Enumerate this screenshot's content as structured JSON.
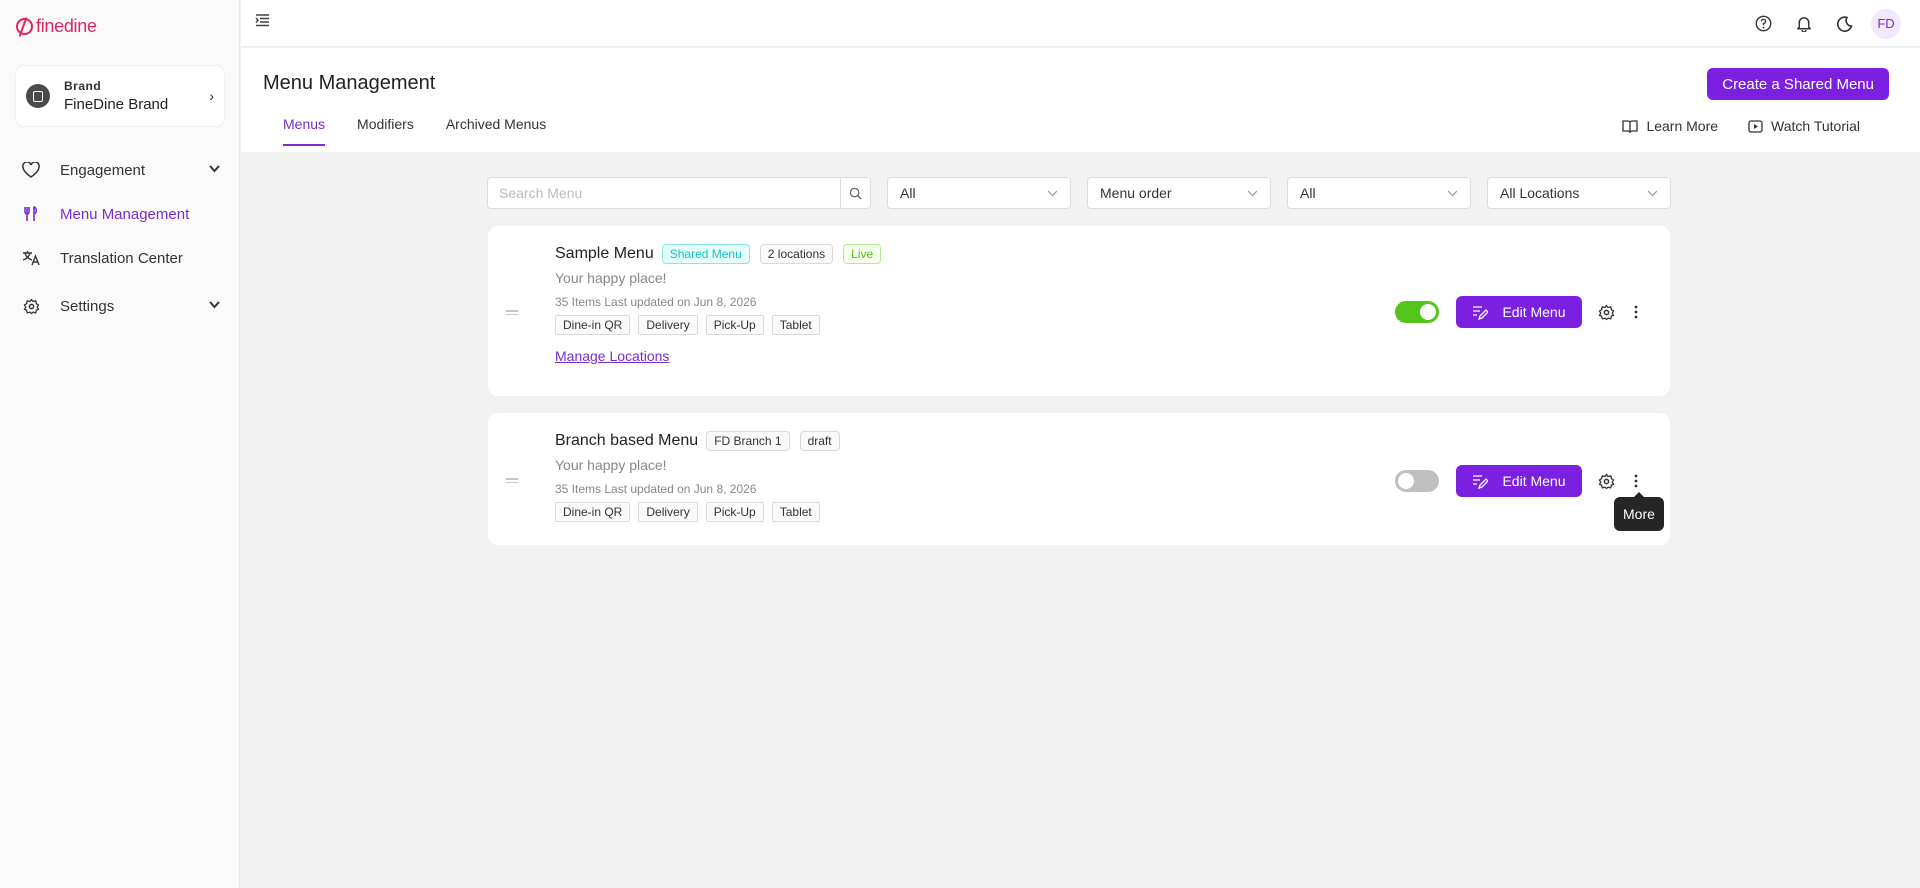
{
  "app": {
    "logo_text": "finedine",
    "brand_color": "#e0245e",
    "accent_color": "#7b2ccb"
  },
  "brand": {
    "label": "Brand",
    "name": "FineDine Brand"
  },
  "sidebar": {
    "items": [
      {
        "label": "Engagement",
        "icon": "heart-icon"
      },
      {
        "label": "Menu Management",
        "icon": "fork-knife-icon"
      },
      {
        "label": "Translation Center",
        "icon": "translate-icon"
      },
      {
        "label": "Settings",
        "icon": "gear-icon"
      }
    ]
  },
  "topbar": {
    "avatar": "FD"
  },
  "page": {
    "title": "Menu Management",
    "create_button": "Create a Shared Menu",
    "tabs": [
      "Menus",
      "Modifiers",
      "Archived Menus"
    ],
    "learn_more": "Learn More",
    "watch_tutorial": "Watch Tutorial"
  },
  "filters": {
    "search_placeholder": "Search Menu",
    "select_1": "All",
    "select_2": "Menu order",
    "select_3": "All",
    "select_4": "All Locations"
  },
  "menus": [
    {
      "name": "Sample Menu",
      "badges": [
        "Shared Menu",
        "2 locations",
        "Live"
      ],
      "description": "Your happy place!",
      "updated": "35 Items Last updated on Jun 8, 2026",
      "channels": [
        "Dine-in QR",
        "Delivery",
        "Pick-Up",
        "Tablet"
      ],
      "manage_link": "Manage Locations",
      "enabled": true,
      "edit_label": "Edit Menu"
    },
    {
      "name": "Branch based Menu",
      "badges": [
        "FD Branch 1",
        "draft"
      ],
      "description": "Your happy place!",
      "updated": "35 Items Last updated on Jun 8, 2026",
      "channels": [
        "Dine-in QR",
        "Delivery",
        "Pick-Up",
        "Tablet"
      ],
      "enabled": false,
      "edit_label": "Edit Menu"
    }
  ],
  "tooltip": "More"
}
